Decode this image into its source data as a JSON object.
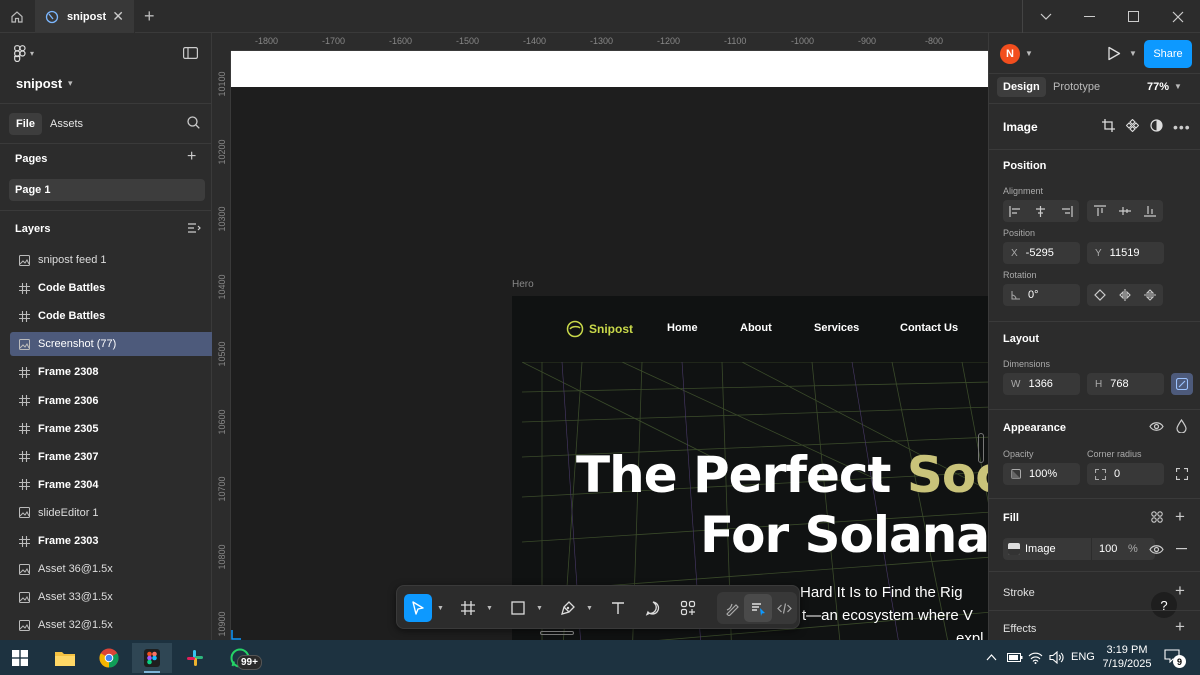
{
  "titlebar": {
    "tab_label": "snipost"
  },
  "left": {
    "project_name": "snipost",
    "tabs": [
      "File",
      "Assets"
    ],
    "pages_title": "Pages",
    "page_item": "Page 1",
    "layers_title": "Layers",
    "layers": [
      {
        "name": "snipost feed 1",
        "icon": "image-icon",
        "bold": false
      },
      {
        "name": "Code Battles",
        "icon": "frame-icon",
        "bold": true
      },
      {
        "name": "Code Battles",
        "icon": "frame-icon",
        "bold": true
      },
      {
        "name": "Screenshot (77)",
        "icon": "image-icon",
        "bold": false,
        "selected": true
      },
      {
        "name": "Frame 2308",
        "icon": "frame-icon",
        "bold": true
      },
      {
        "name": "Frame 2306",
        "icon": "frame-icon",
        "bold": true
      },
      {
        "name": "Frame 2305",
        "icon": "frame-icon",
        "bold": true
      },
      {
        "name": "Frame 2307",
        "icon": "frame-icon",
        "bold": true
      },
      {
        "name": "Frame 2304",
        "icon": "frame-icon",
        "bold": true
      },
      {
        "name": "slideEditor 1",
        "icon": "image-icon",
        "bold": false
      },
      {
        "name": "Frame 2303",
        "icon": "frame-icon",
        "bold": true
      },
      {
        "name": "Asset 36@1.5x",
        "icon": "image-icon",
        "bold": false
      },
      {
        "name": "Asset 33@1.5x",
        "icon": "image-icon",
        "bold": false
      },
      {
        "name": "Asset 32@1.5x",
        "icon": "image-icon",
        "bold": false
      }
    ]
  },
  "canvas": {
    "ruler_x": [
      "-1800",
      "-1700",
      "-1600",
      "-1500",
      "-1400",
      "-1300",
      "-1200",
      "-1100",
      "-1000",
      "-900",
      "-800"
    ],
    "ruler_y": [
      "10100",
      "10200",
      "10300",
      "10400",
      "10500",
      "10600",
      "10700",
      "10800",
      "10900"
    ],
    "frame_label": "Hero",
    "hero": {
      "logo_text": "Snipost",
      "nav": [
        "Home",
        "About",
        "Services",
        "Contact Us"
      ],
      "h1_a": "The Perfect ",
      "h1_b": "Soc",
      "h2": "For Solana",
      "p1": "Hard It Is to Find the Rig",
      "p2": "t—an ecosystem where V",
      "p3": "expl"
    }
  },
  "right": {
    "avatar_initial": "N",
    "share_label": "Share",
    "tabs": [
      "Design",
      "Prototype"
    ],
    "zoom": "77%",
    "element_type": "Image",
    "position_title": "Position",
    "alignment_label": "Alignment",
    "position_label": "Position",
    "x_prefix": "X",
    "x_value": "-5295",
    "y_prefix": "Y",
    "y_value": "11519",
    "rotation_label": "Rotation",
    "rotation_value": "0°",
    "layout_title": "Layout",
    "dimensions_label": "Dimensions",
    "w_prefix": "W",
    "w_value": "1366",
    "h_prefix": "H",
    "h_value": "768",
    "appearance_title": "Appearance",
    "opacity_label": "Opacity",
    "opacity_value": "100%",
    "corner_label": "Corner radius",
    "corner_value": "0",
    "fill_title": "Fill",
    "fill_type": "Image",
    "fill_opacity": "100",
    "fill_pct": "%",
    "stroke_title": "Stroke",
    "effects_title": "Effects",
    "help": "?"
  },
  "taskbar": {
    "whatsapp_badge": "99+",
    "lang": "ENG",
    "time": "3:19 PM",
    "date": "7/19/2025",
    "notif_count": "9"
  },
  "colors": {
    "accent": "#0d99ff",
    "selection": "#4d5a7b",
    "avatar": "#f24e1e",
    "logo": "#c9d94a"
  }
}
